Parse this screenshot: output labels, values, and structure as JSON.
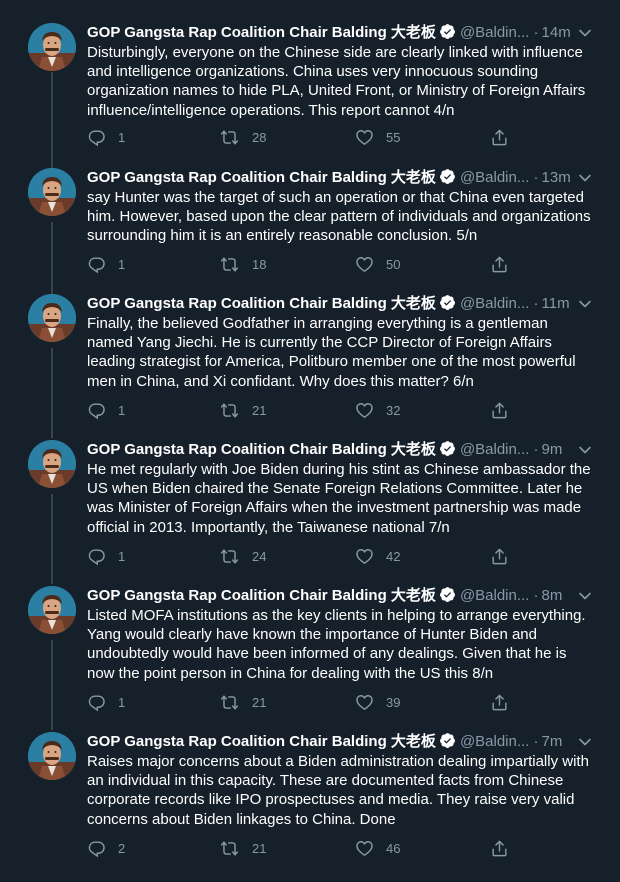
{
  "colors": {
    "background": "#15202b",
    "text": "#ffffff",
    "secondary": "#8899a6",
    "verified": "#ffffff",
    "divider": "#38444d"
  },
  "icons": {
    "reply": "reply-icon",
    "retweet": "retweet-icon",
    "like": "heart-icon",
    "share": "share-icon",
    "more": "chevron-down-icon",
    "verified": "verified-badge-icon"
  },
  "tweets": [
    {
      "name": "GOP Gangsta Rap Coalition Chair Balding 大老板",
      "handle": "@Baldin...",
      "sep": "·",
      "time": "14m",
      "text": "Disturbingly, everyone on the Chinese side are clearly linked with influence and intelligence organizations. China uses very innocuous sounding organization names to hide PLA, United Front, or Ministry of Foreign Affairs influence/intelligence operations. This report cannot 4/n",
      "replies": "1",
      "retweets": "28",
      "likes": "55"
    },
    {
      "name": "GOP Gangsta Rap Coalition Chair Balding 大老板",
      "handle": "@Baldin...",
      "sep": "·",
      "time": "13m",
      "text": "say Hunter was the target of such an operation or that China even targeted him. However, based upon the clear pattern of individuals and organizations surrounding him it is an entirely reasonable conclusion. 5/n",
      "replies": "1",
      "retweets": "18",
      "likes": "50"
    },
    {
      "name": "GOP Gangsta Rap Coalition Chair Balding 大老板",
      "handle": "@Baldin...",
      "sep": "·",
      "time": "11m",
      "text": "Finally, the believed Godfather in arranging everything is a gentleman named Yang Jiechi. He is currently the CCP Director of Foreign Affairs leading strategist for America, Politburo member one of the most powerful men in China, and Xi confidant. Why does this matter? 6/n",
      "replies": "1",
      "retweets": "21",
      "likes": "32"
    },
    {
      "name": "GOP Gangsta Rap Coalition Chair Balding 大老板",
      "handle": "@Baldin...",
      "sep": "·",
      "time": "9m",
      "text": "He met regularly with Joe Biden during his stint as Chinese ambassador the US when Biden chaired the Senate Foreign Relations Committee.  Later he was Minister of Foreign Affairs when the investment partnership was made official in 2013. Importantly, the Taiwanese national 7/n",
      "replies": "1",
      "retweets": "24",
      "likes": "42"
    },
    {
      "name": "GOP Gangsta Rap Coalition Chair Balding 大老板",
      "handle": "@Baldin...",
      "sep": "·",
      "time": "8m",
      "text": "Listed MOFA institutions as the key clients in helping to arrange everything. Yang would clearly have known the importance of Hunter Biden and undoubtedly would have been informed of any dealings. Given that he is now the point person in China for dealing with the US this 8/n",
      "replies": "1",
      "retweets": "21",
      "likes": "39"
    },
    {
      "name": "GOP Gangsta Rap Coalition Chair Balding 大老板",
      "handle": "@Baldin...",
      "sep": "·",
      "time": "7m",
      "text": "Raises major concerns about a Biden administration dealing impartially with an individual in this capacity. These are documented facts from Chinese corporate records like IPO prospectuses and media. They raise very valid concerns about Biden linkages to China. Done",
      "replies": "2",
      "retweets": "21",
      "likes": "46"
    }
  ]
}
